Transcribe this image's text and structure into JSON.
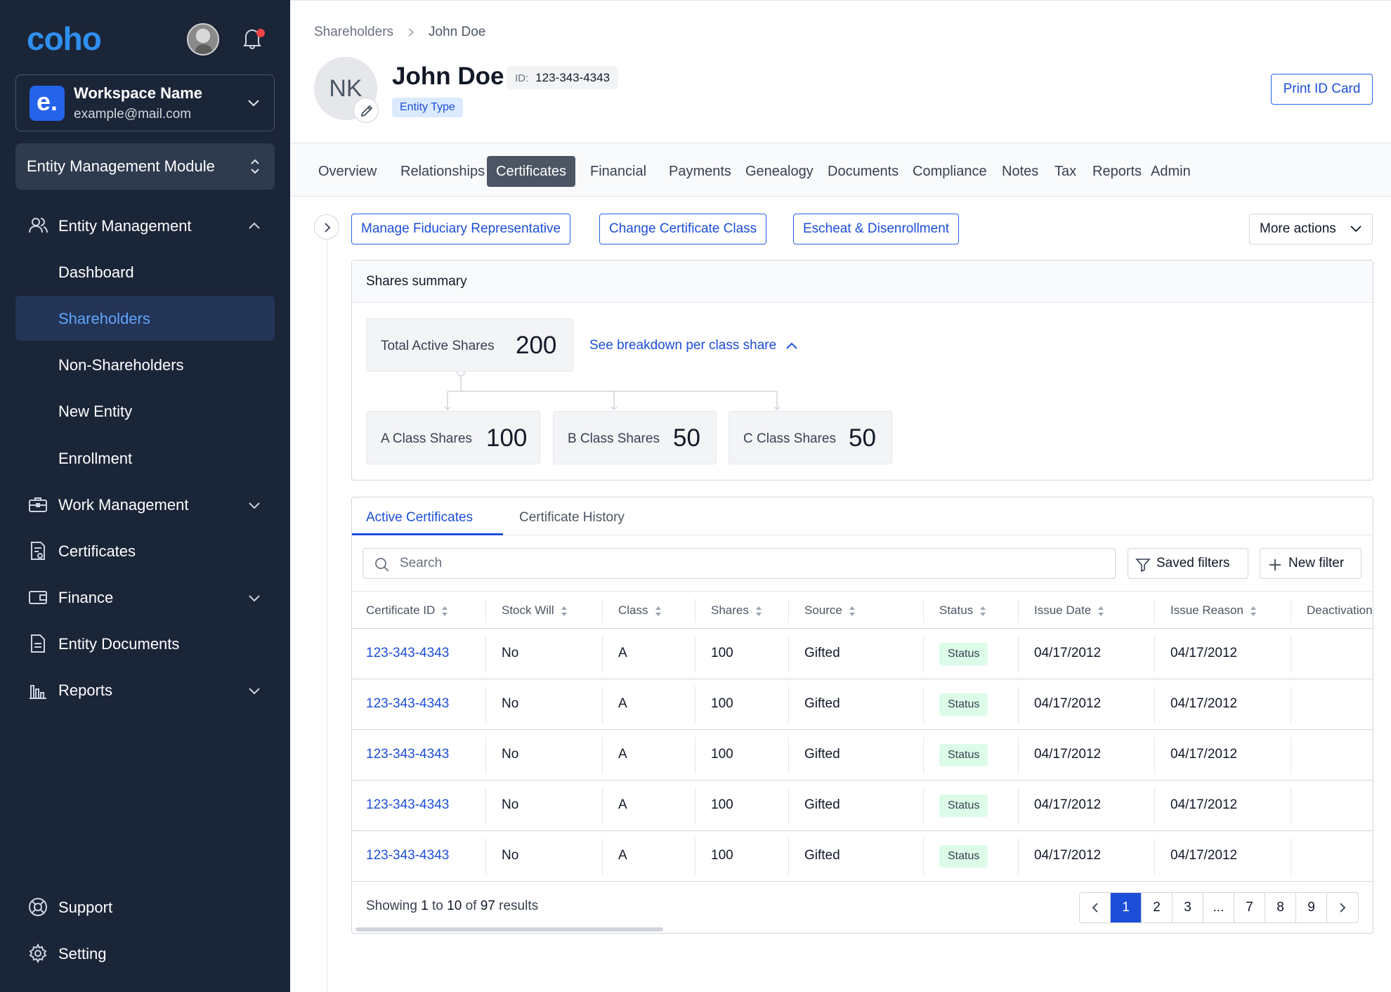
{
  "app": {
    "logo": "coho"
  },
  "workspace": {
    "badge": "e.",
    "name": "Workspace Name",
    "email": "example@mail.com"
  },
  "module": {
    "label": "Entity Management Module"
  },
  "sidebar": {
    "items": [
      {
        "label": "Entity Management",
        "icon": "users-icon",
        "expanded": true
      },
      {
        "label": "Dashboard"
      },
      {
        "label": "Shareholders",
        "active": true
      },
      {
        "label": "Non-Shareholders"
      },
      {
        "label": "New Entity"
      },
      {
        "label": "Enrollment"
      },
      {
        "label": "Work Management",
        "icon": "briefcase-icon"
      },
      {
        "label": "Certificates",
        "icon": "certificate-icon"
      },
      {
        "label": "Finance",
        "icon": "wallet-icon"
      },
      {
        "label": "Entity Documents",
        "icon": "document-icon"
      },
      {
        "label": "Reports",
        "icon": "bar-chart-icon"
      }
    ],
    "footer": [
      {
        "label": "Support",
        "icon": "lifebuoy-icon"
      },
      {
        "label": "Setting",
        "icon": "gear-icon"
      }
    ]
  },
  "breadcrumb": {
    "parent": "Shareholders",
    "current": "John Doe"
  },
  "profile": {
    "initials": "NK",
    "name": "John Doe",
    "id_label": "ID:",
    "id_value": "123-343-4343",
    "entity_type": "Entity Type",
    "print_button": "Print ID Card"
  },
  "tabs": [
    "Overview",
    "Relationships",
    "Certificates",
    "Financial",
    "Payments",
    "Genealogy",
    "Documents",
    "Compliance",
    "Notes",
    "Tax",
    "Reports",
    "Admin"
  ],
  "active_tab": "Certificates",
  "actions": {
    "manage_fiduciary": "Manage Fiduciary Representative",
    "change_class": "Change Certificate Class",
    "escheat": "Escheat & Disenrollment",
    "more": "More actions"
  },
  "summary": {
    "title": "Shares summary",
    "total_label": "Total Active Shares",
    "total_value": "200",
    "breakdown_link": "See breakdown per class share",
    "classes": [
      {
        "label": "A Class Shares",
        "value": "100"
      },
      {
        "label": "B Class Shares",
        "value": "50"
      },
      {
        "label": "C Class Shares",
        "value": "50"
      }
    ]
  },
  "certificates": {
    "tabs": {
      "active": "Active Certificates",
      "history": "Certificate History"
    },
    "search_placeholder": "Search",
    "saved_filters": "Saved filters",
    "new_filter": "New filter",
    "columns": [
      "Certificate ID",
      "Stock Will",
      "Class",
      "Shares",
      "Source",
      "Status",
      "Issue Date",
      "Issue Reason",
      "Deactivation"
    ],
    "rows": [
      {
        "id": "123-343-4343",
        "stock_will": "No",
        "class": "A",
        "shares": "100",
        "source": "Gifted",
        "status": "Status",
        "issue_date": "04/17/2012",
        "issue_reason": "04/17/2012"
      },
      {
        "id": "123-343-4343",
        "stock_will": "No",
        "class": "A",
        "shares": "100",
        "source": "Gifted",
        "status": "Status",
        "issue_date": "04/17/2012",
        "issue_reason": "04/17/2012"
      },
      {
        "id": "123-343-4343",
        "stock_will": "No",
        "class": "A",
        "shares": "100",
        "source": "Gifted",
        "status": "Status",
        "issue_date": "04/17/2012",
        "issue_reason": "04/17/2012"
      },
      {
        "id": "123-343-4343",
        "stock_will": "No",
        "class": "A",
        "shares": "100",
        "source": "Gifted",
        "status": "Status",
        "issue_date": "04/17/2012",
        "issue_reason": "04/17/2012"
      },
      {
        "id": "123-343-4343",
        "stock_will": "No",
        "class": "A",
        "shares": "100",
        "source": "Gifted",
        "status": "Status",
        "issue_date": "04/17/2012",
        "issue_reason": "04/17/2012"
      }
    ],
    "results": {
      "prefix": "Showing",
      "from": "1",
      "to_word": "to",
      "to": "10",
      "of_word": "of",
      "total": "97",
      "suffix": "results"
    },
    "pages": [
      "1",
      "2",
      "3",
      "...",
      "7",
      "8",
      "9"
    ],
    "current_page": "1"
  },
  "colors": {
    "sidebar_bg": "#1b2538",
    "accent": "#1d4ed8",
    "brand": "#2f8ff0",
    "status_bg": "#dcfce7",
    "active_tab_bg": "#4b5563"
  }
}
